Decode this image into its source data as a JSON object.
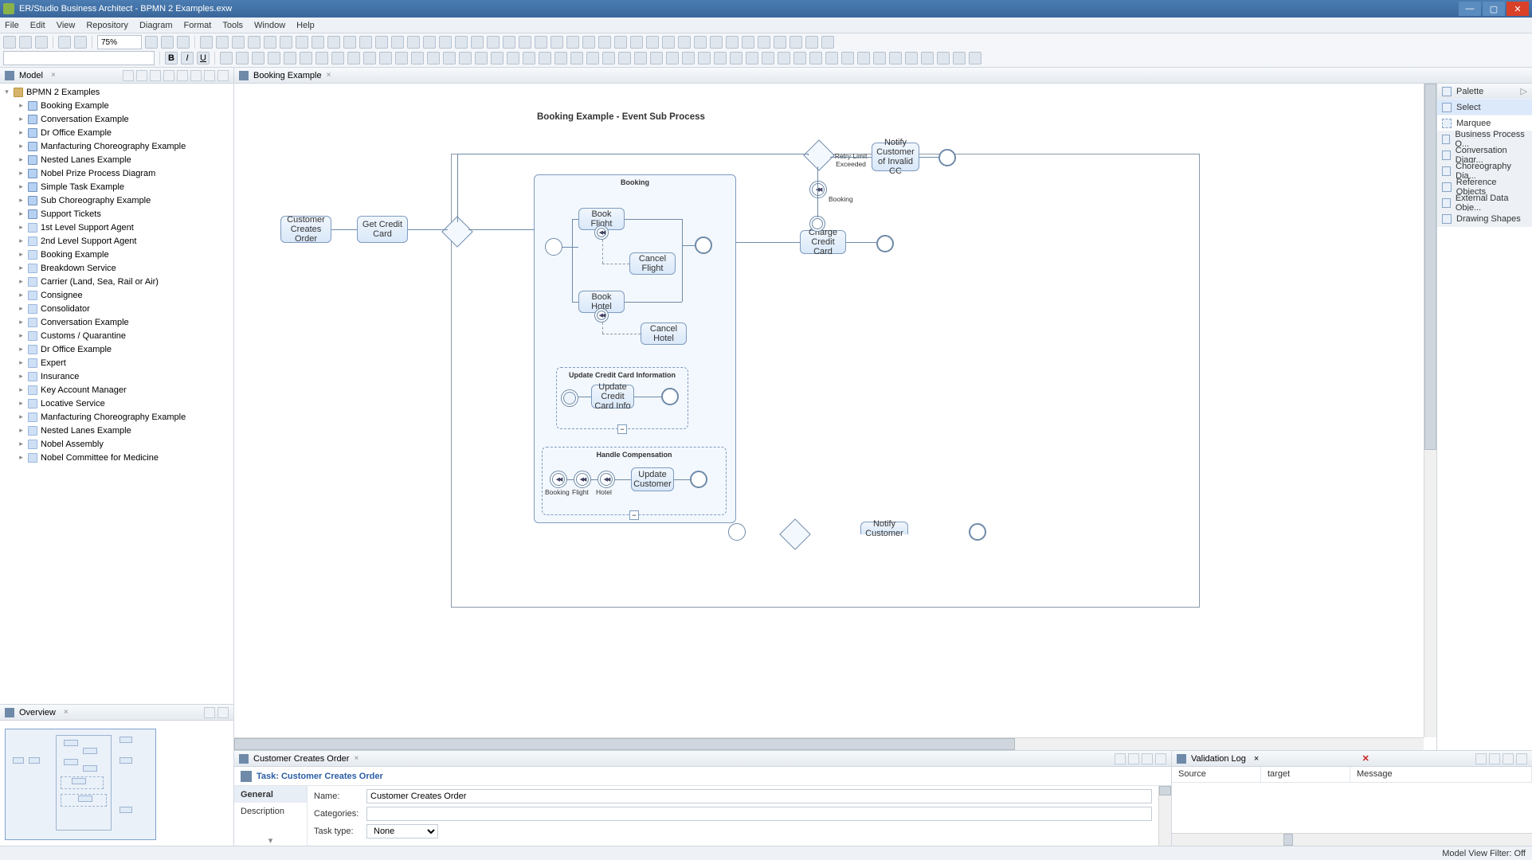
{
  "app": {
    "title": "ER/Studio Business Architect - BPMN 2 Examples.exw"
  },
  "menu": [
    "File",
    "Edit",
    "View",
    "Repository",
    "Diagram",
    "Format",
    "Tools",
    "Window",
    "Help"
  ],
  "toolbar": {
    "zoom": "75%"
  },
  "model_panel": {
    "title": "Model",
    "root": "BPMN 2 Examples",
    "items": [
      {
        "label": "Booking Example",
        "icon": "diagram"
      },
      {
        "label": "Conversation Example",
        "icon": "diagram"
      },
      {
        "label": "Dr Office Example",
        "icon": "diagram"
      },
      {
        "label": "Manfacturing Choreography Example",
        "icon": "diagram"
      },
      {
        "label": "Nested Lanes Example",
        "icon": "diagram"
      },
      {
        "label": "Nobel Prize Process Diagram",
        "icon": "diagram"
      },
      {
        "label": "Simple Task Example",
        "icon": "diagram"
      },
      {
        "label": "Sub Choreography Example",
        "icon": "diagram"
      },
      {
        "label": "Support Tickets",
        "icon": "diagram"
      },
      {
        "label": "1st Level Support Agent",
        "icon": "pool"
      },
      {
        "label": "2nd Level Support Agent",
        "icon": "pool"
      },
      {
        "label": "Booking Example",
        "icon": "pool"
      },
      {
        "label": "Breakdown Service",
        "icon": "pool"
      },
      {
        "label": "Carrier (Land, Sea, Rail or Air)",
        "icon": "pool"
      },
      {
        "label": "Consignee",
        "icon": "pool"
      },
      {
        "label": "Consolidator",
        "icon": "pool"
      },
      {
        "label": "Conversation Example",
        "icon": "pool"
      },
      {
        "label": "Customs / Quarantine",
        "icon": "pool"
      },
      {
        "label": "Dr Office Example",
        "icon": "pool"
      },
      {
        "label": "Expert",
        "icon": "pool"
      },
      {
        "label": "Insurance",
        "icon": "pool"
      },
      {
        "label": "Key Account Manager",
        "icon": "pool"
      },
      {
        "label": "Locative Service",
        "icon": "pool"
      },
      {
        "label": "Manfacturing Choreography Example",
        "icon": "pool"
      },
      {
        "label": "Nested Lanes Example",
        "icon": "pool"
      },
      {
        "label": "Nobel Assembly",
        "icon": "pool"
      },
      {
        "label": "Nobel Committee for Medicine",
        "icon": "pool"
      }
    ]
  },
  "overview": {
    "title": "Overview"
  },
  "editor": {
    "tab": "Booking Example"
  },
  "diagram": {
    "title": "Booking Example - Event Sub Process",
    "tasks": {
      "customer_creates_order": "Customer Creates Order",
      "get_credit_card": "Get Credit Card",
      "book_flight": "Book Flight",
      "cancel_flight": "Cancel Flight",
      "book_hotel": "Book Hotel",
      "cancel_hotel": "Cancel Hotel",
      "update_cc": "Update Credit Card Info",
      "update_customer": "Update Customer",
      "charge_credit_card": "Charge Credit Card",
      "notify_invalid_cc": "Notify Customer of Invalid CC",
      "notify_customer": "Notify Customer"
    },
    "subproc": {
      "booking": "Booking",
      "update_cc": "Update Credit Card Information",
      "handle_comp": "Handle Compensation"
    },
    "labels": {
      "retry_limit": "Retry Limit Exceeded",
      "booking": "Booking",
      "booking2": "Booking",
      "flight": "Flight",
      "hotel": "Hotel"
    }
  },
  "props": {
    "tab": "Customer Creates Order",
    "heading": "Task: Customer Creates Order",
    "side": {
      "general": "General",
      "description": "Description"
    },
    "fields": {
      "name_label": "Name:",
      "name_value": "Customer Creates Order",
      "categories_label": "Categories:",
      "categories_value": "",
      "tasktype_label": "Task type:",
      "tasktype_value": "None"
    }
  },
  "validation": {
    "title": "Validation Log",
    "cols": {
      "source": "Source",
      "target": "target",
      "message": "Message"
    }
  },
  "palette": {
    "title": "Palette",
    "select": "Select",
    "marquee": "Marquee",
    "groups": [
      "Business Process O...",
      "Conversation Diagr...",
      "Choreography  Dia...",
      "Reference Objects",
      "External Data Obje...",
      "Drawing Shapes"
    ]
  },
  "status": {
    "filter": "Model View Filter: Off"
  }
}
